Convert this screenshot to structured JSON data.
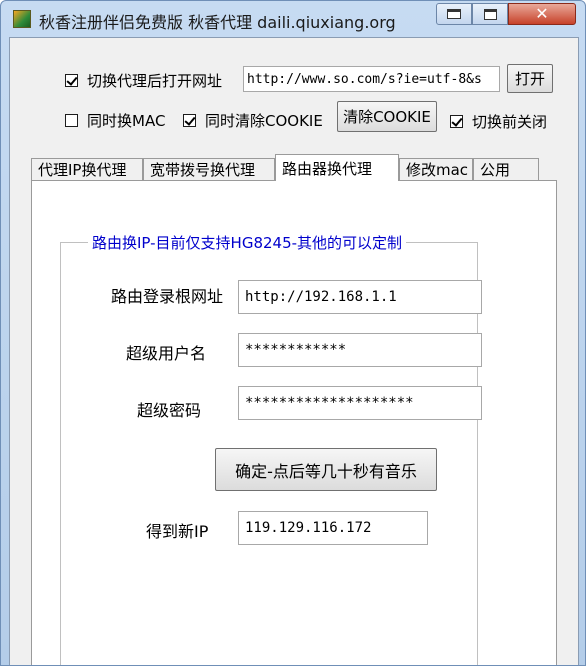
{
  "window": {
    "title": "秋香注册伴侣免费版 秋香代理 daili.qiuxiang.org",
    "minimize_label": "minimize",
    "maximize_label": "maximize",
    "close_glyph": "✕"
  },
  "top": {
    "open_url_checkbox": {
      "label": "切换代理后打开网址",
      "checked": true
    },
    "url_value": "http://www.so.com/s?ie=utf-8&s",
    "open_button": "打开",
    "mac_checkbox": {
      "label": "同时换MAC",
      "checked": false
    },
    "clear_cookie_checkbox": {
      "label": "同时清除COOKIE",
      "checked": true
    },
    "clear_cookie_button": "清除COOKIE",
    "close_before_checkbox": {
      "label": "切换前关闭",
      "checked": true
    }
  },
  "tabs": [
    {
      "label": "代理IP换代理",
      "active": false
    },
    {
      "label": "宽带拨号换代理",
      "active": false
    },
    {
      "label": "路由器换代理",
      "active": true
    },
    {
      "label": "修改mac",
      "active": false
    },
    {
      "label": "公用",
      "active": false
    }
  ],
  "router": {
    "group_title": "路由换IP-目前仅支持HG8245-其他的可以定制",
    "root_url_label": "路由登录根网址",
    "root_url_value": "http://192.168.1.1",
    "username_label": "超级用户名",
    "username_value": "************",
    "password_label": "超级密码",
    "password_value": "********************",
    "confirm_button": "确定-点后等几十秒有音乐",
    "new_ip_label": "得到新IP",
    "new_ip_value": "119.129.116.172"
  }
}
